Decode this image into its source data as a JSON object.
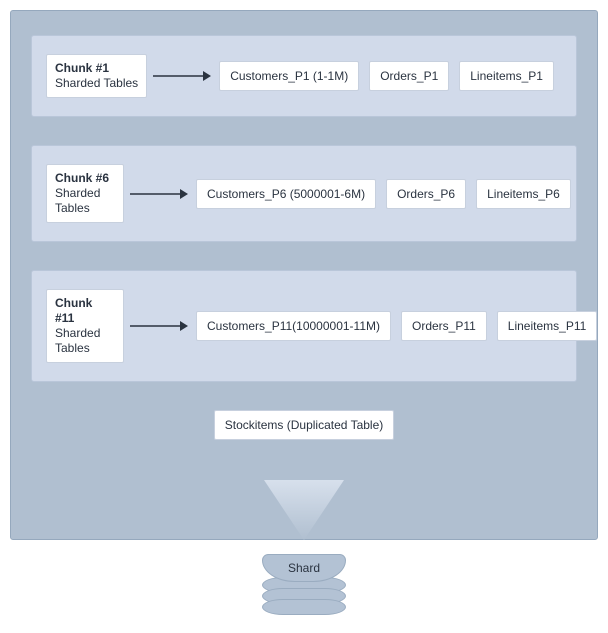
{
  "shard_label": "Shard",
  "duplicated_table": "Stockitems (Duplicated Table)",
  "chunks": [
    {
      "title": "Chunk #1",
      "subtitle": "Sharded Tables",
      "customers": "Customers_P1 (1-1M)",
      "orders": "Orders_P1",
      "lineitems": "Lineitems_P1"
    },
    {
      "title": "Chunk #6",
      "subtitle": "Sharded Tables",
      "customers": "Customers_P6 (5000001-6M)",
      "orders": "Orders_P6",
      "lineitems": "Lineitems_P6"
    },
    {
      "title": "Chunk #11",
      "subtitle": "Sharded Tables",
      "customers": "Customers_P11(10000001-11M)",
      "orders": "Orders_P11",
      "lineitems": "Lineitems_P11"
    }
  ]
}
